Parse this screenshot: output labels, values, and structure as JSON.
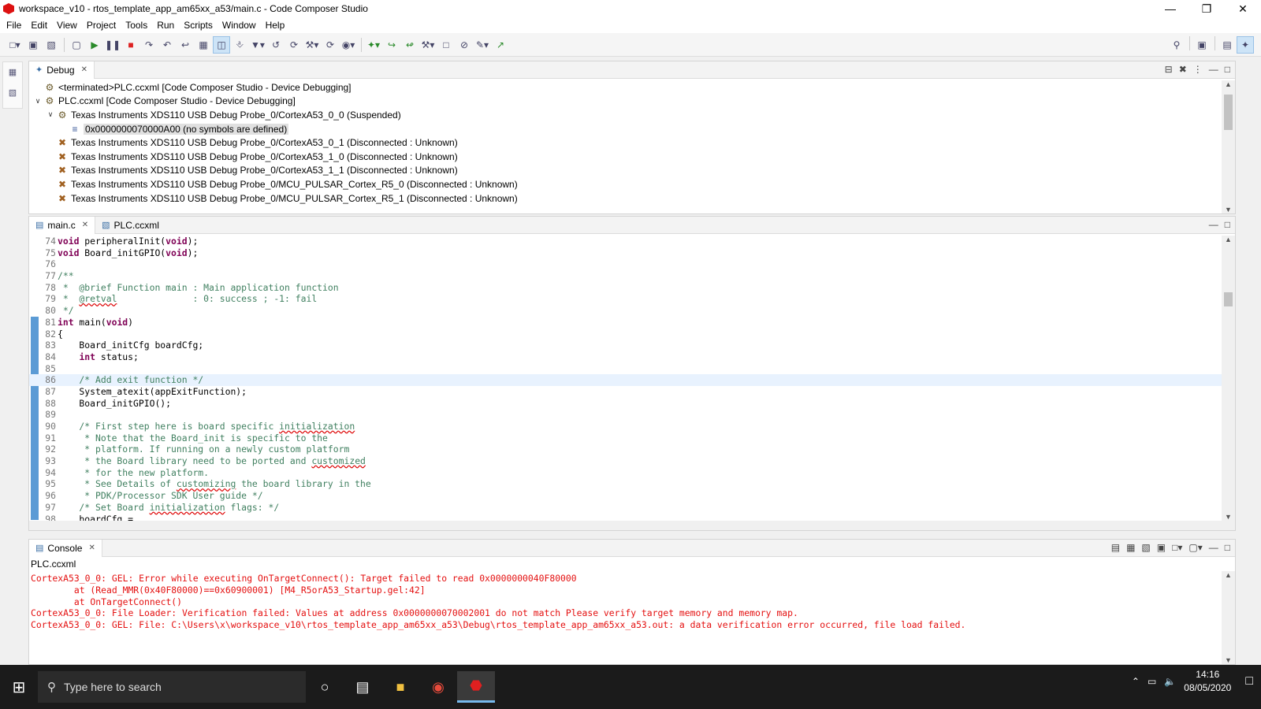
{
  "window": {
    "title": "workspace_v10 - rtos_template_app_am65xx_a53/main.c - Code Composer Studio"
  },
  "menu": [
    "File",
    "Edit",
    "View",
    "Project",
    "Tools",
    "Run",
    "Scripts",
    "Window",
    "Help"
  ],
  "debug": {
    "tab": "Debug",
    "rows": [
      {
        "text": "<terminated>PLC.ccxml [Code Composer Studio - Device Debugging]",
        "indent": 0,
        "twisty": "",
        "icon": "gear-icon"
      },
      {
        "text": "PLC.ccxml [Code Composer Studio - Device Debugging]",
        "indent": 0,
        "twisty": "v",
        "icon": "gear-icon"
      },
      {
        "text": "Texas Instruments XDS110 USB Debug Probe_0/CortexA53_0_0 (Suspended)",
        "indent": 1,
        "twisty": "v",
        "icon": "probe-icon"
      },
      {
        "text": "0x0000000070000A00  (no symbols are defined)",
        "indent": 2,
        "twisty": "",
        "icon": "stack-frame-icon"
      },
      {
        "text": "Texas Instruments XDS110 USB Debug Probe_0/CortexA53_0_1 (Disconnected : Unknown)",
        "indent": 1,
        "twisty": "",
        "icon": "probe-disconnected-icon"
      },
      {
        "text": "Texas Instruments XDS110 USB Debug Probe_0/CortexA53_1_0 (Disconnected : Unknown)",
        "indent": 1,
        "twisty": "",
        "icon": "probe-disconnected-icon"
      },
      {
        "text": "Texas Instruments XDS110 USB Debug Probe_0/CortexA53_1_1 (Disconnected : Unknown)",
        "indent": 1,
        "twisty": "",
        "icon": "probe-disconnected-icon"
      },
      {
        "text": "Texas Instruments XDS110 USB Debug Probe_0/MCU_PULSAR_Cortex_R5_0 (Disconnected : Unknown)",
        "indent": 1,
        "twisty": "",
        "icon": "probe-disconnected-icon"
      },
      {
        "text": "Texas Instruments XDS110 USB Debug Probe_0/MCU_PULSAR_Cortex_R5_1 (Disconnected : Unknown)",
        "indent": 1,
        "twisty": "",
        "icon": "probe-disconnected-icon"
      }
    ]
  },
  "editor": {
    "tabs": [
      "main.c",
      "PLC.ccxml"
    ],
    "lines": [
      {
        "n": "74",
        "code": "void peripheralInit(void);"
      },
      {
        "n": "75",
        "code": "void Board_initGPIO(void);"
      },
      {
        "n": "76",
        "code": ""
      },
      {
        "n": "77",
        "code": "/**"
      },
      {
        "n": "78",
        "code": " *  @brief Function main : Main application function"
      },
      {
        "n": "79",
        "code": " *  @retval              : 0: success ; -1: fail"
      },
      {
        "n": "80",
        "code": " */"
      },
      {
        "n": "81",
        "code": "int main(void)"
      },
      {
        "n": "82",
        "code": "{"
      },
      {
        "n": "83",
        "code": "    Board_initCfg boardCfg;"
      },
      {
        "n": "84",
        "code": "    int status;"
      },
      {
        "n": "85",
        "code": ""
      },
      {
        "n": "86",
        "code": "    /* Add exit function */"
      },
      {
        "n": "87",
        "code": "    System_atexit(appExitFunction);"
      },
      {
        "n": "88",
        "code": "    Board_initGPIO();"
      },
      {
        "n": "89",
        "code": ""
      },
      {
        "n": "90",
        "code": "    /* First step here is board specific initialization"
      },
      {
        "n": "91",
        "code": "     * Note that the Board_init is specific to the"
      },
      {
        "n": "92",
        "code": "     * platform. If running on a newly custom platform"
      },
      {
        "n": "93",
        "code": "     * the Board library need to be ported and customized"
      },
      {
        "n": "94",
        "code": "     * for the new platform."
      },
      {
        "n": "95",
        "code": "     * See Details of customizing the board library in the"
      },
      {
        "n": "96",
        "code": "     * PDK/Processor SDK User guide */"
      },
      {
        "n": "97",
        "code": "    /* Set Board initialization flags: */"
      },
      {
        "n": "98",
        "code": "    boardCfg ="
      }
    ]
  },
  "console": {
    "tab": "Console",
    "name": "PLC.ccxml",
    "lines": [
      "CortexA53_0_0: GEL: Error while executing OnTargetConnect(): Target failed to read 0x0000000040F80000",
      "        at (Read_MMR(0x40F80000)==0x60900001) [M4_R5orA53_Startup.gel:42]",
      "        at OnTargetConnect()",
      "CortexA53_0_0: File Loader: Verification failed: Values at address 0x0000000070002001 do not match Please verify target memory and memory map.",
      "CortexA53_0_0: GEL: File: C:\\Users\\x\\workspace_v10\\rtos_template_app_am65xx_a53\\Debug\\rtos_template_app_am65xx_a53.out: a data verification error occurred, file load failed."
    ]
  },
  "taskbar": {
    "search_placeholder": "Type here to search",
    "time": "14:16",
    "date": "08/05/2020"
  }
}
